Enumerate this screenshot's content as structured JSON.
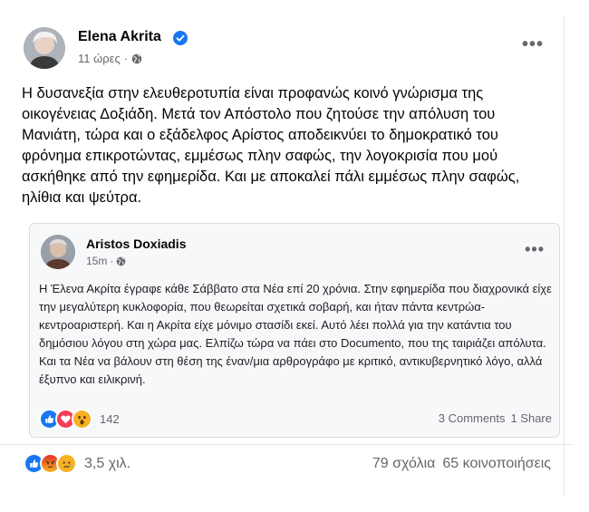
{
  "post": {
    "author": "Elena Akrita",
    "time": "11 ώρες",
    "meta_sep": "·",
    "more": "•••",
    "text": "Η δυσανεξία στην ελευθεροτυπία είναι προφανώς κοινό γνώρισμα της οικογένειας Δοξιάδη. Μετά τον Απόστολο που ζητούσε την απόλυση του Μανιάτη, τώρα και ο εξάδελφος Αρίστος αποδεικνύει το δημοκρατικό του φρόνημα επικροτώντας, εμμέσως πλην σαφώς, την λογοκρισία που μού ασκήθηκε από την εφημερίδα. Και με αποκαλεί πάλι εμμέσως πλην σαφώς, ηλίθια και ψεύτρα.",
    "reactions_count": "3,5 χιλ.",
    "comments": "79 σχόλια",
    "shares": "65 κοινοποιήσεις"
  },
  "shared_post": {
    "author": "Aristos Doxiadis",
    "time": "15m",
    "meta_sep": "·",
    "more": "•••",
    "text": "Η Έλενα Ακρίτα έγραφε κάθε Σάββατο στα Νέα επί 20 χρόνια. Στην εφημερίδα που διαχρονικά είχε την μεγαλύτερη κυκλοφορία, που θεωρείται σχετικά σοβαρή, και ήταν πάντα κεντρώα-κεντροαριστερή. Και η Ακρίτα είχε μόνιμο στασίδι εκεί. Αυτό λέει πολλά για την κατάντια του δημόσιου λόγου στη χώρα μας. Ελπίζω τώρα να πάει στο Documento, που της ταιριάζει απόλυτα. Και τα Νέα να βάλουν στη θέση της έναν/μια αρθρογράφο με κριτικό, αντικυβερνητικό λόγο, αλλά έξυπνο και ειλικρινή.",
    "reactions_count": "142",
    "comments": "3 Comments",
    "shares": "1 Share"
  },
  "colors": {
    "like": "#1877f2",
    "love": "#f33e58",
    "haha": "#f7b125",
    "angry": "#e9710f",
    "secondary_text": "#65676b"
  },
  "icons": {
    "verified": "verified-badge-icon",
    "globe": "globe-icon",
    "like": "like-reaction-icon",
    "love": "love-reaction-icon",
    "wow": "wow-reaction-icon",
    "angry": "angry-reaction-icon",
    "sad": "sad-reaction-icon"
  }
}
